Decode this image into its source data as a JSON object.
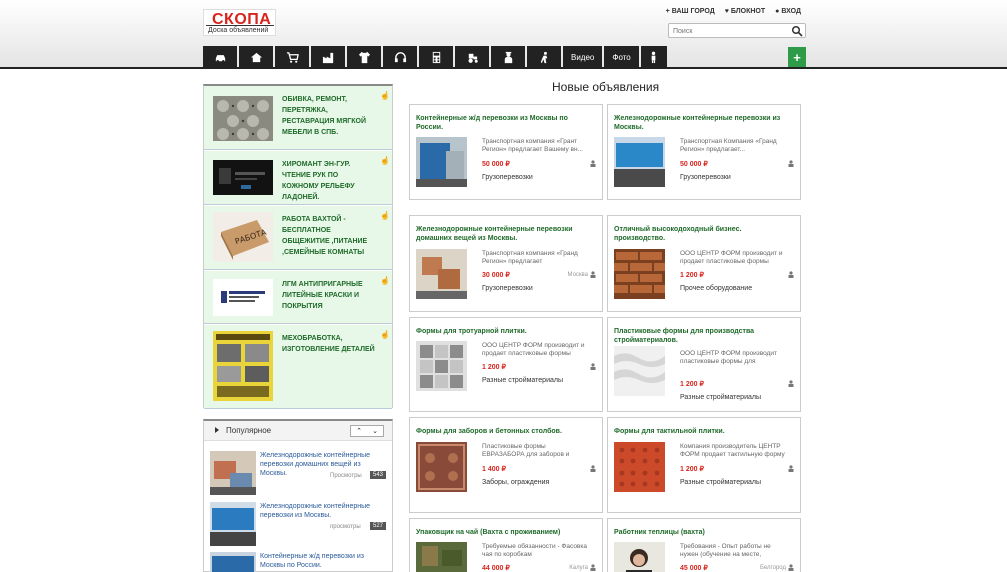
{
  "header": {
    "logo_text": "СКОПА",
    "logo_subtitle": "Доска объявлений",
    "links": [
      {
        "icon": "plus-icon",
        "label": "ВАШ ГОРОД"
      },
      {
        "icon": "heart-icon",
        "label": "БЛОКНОТ"
      },
      {
        "icon": "user-icon",
        "label": "ВХОД"
      }
    ],
    "search_placeholder": "Поиск",
    "add_label": "+"
  },
  "nav": {
    "icons": [
      "car-icon",
      "house-icon",
      "cart-icon",
      "factory-icon",
      "shirt-icon",
      "headphones-icon",
      "calculator-icon",
      "tractor-icon",
      "worker-icon",
      "person-walk-icon"
    ],
    "video_label": "Видео",
    "photo_label": "Фото",
    "last_icon": "person-icon"
  },
  "ads": [
    {
      "title": "ОБИВКА, РЕМОНТ, ПЕРЕТЯЖКА, РЕСТАВРАЦИЯ МЯГКОЙ МЕБЕЛИ В СПБ.",
      "image": "quilted-leather"
    },
    {
      "title": "ХИРОМАНТ ЭН-ГУР. ЧТЕНИЕ РУК ПО КОЖНОМУ РЕЛЬЕФУ ЛАДОНЕЙ.",
      "image": "dark-card"
    },
    {
      "title": "РАБОТА ВАХТОЙ - БЕСПЛАТНОЕ ОБЩЕЖИТИЕ ,ПИТАНИЕ ,СЕМЕЙНЫЕ КОМНАТЫ",
      "image": "work-box"
    },
    {
      "title": "ЛГМ АНТИПРИГАРНЫЕ ЛИТЕЙНЫЕ КРАСКИ И ПОКРЫТИЯ",
      "image": "logo-doc"
    },
    {
      "title": "МЕХОБРАБОТКА, ИЗГОТОВЛЕНИЕ ДЕТАЛЕЙ",
      "image": "yellow-flyer"
    }
  ],
  "popular": {
    "title": "Популярное",
    "items": [
      {
        "text": "Железнодорожные контейнерные перевозки домашних вещей из Москвы.",
        "views_label": "Просмотры",
        "count": "543"
      },
      {
        "text": "Железнодорожные контейнерные перевозки из Москвы.",
        "views_label": "просмотры",
        "count": "527"
      },
      {
        "text": "Контейнерные ж/д перевозки из Москвы по России.",
        "views_label": "",
        "count": ""
      }
    ]
  },
  "main": {
    "title": "Новые объявления",
    "cards": [
      {
        "title": "Контейнерные ж/д перевозки из Москвы по России.",
        "desc": "Транспортная компания «Грант Регион» предлагает Вашему вн...",
        "price": "50 000 ₽",
        "category": "Грузоперевозки",
        "city": "",
        "image": "container-blue"
      },
      {
        "title": "Железнодорожные контейнерные перевозки из Москвы.",
        "desc": "Транспортная Компания «Гранд Регион» предлагает...",
        "price": "50 000 ₽",
        "category": "Грузоперевозки",
        "city": "",
        "image": "train-blue"
      },
      {
        "title": "Железнодорожные контейнерные перевозки домашних вещей из Москвы.",
        "desc": "Транспортная компания «Гранд Регион» предлагает",
        "price": "30 000 ₽",
        "category": "Грузоперевозки",
        "city": "Москва",
        "image": "boxes"
      },
      {
        "title": "Отличный высокодоходный бизнес. производство.",
        "desc": "ООО ЦЕНТР ФОРМ производит и продает пластиковые формы",
        "price": "1 200 ₽",
        "category": "Прочее оборудование",
        "city": "",
        "image": "bricks"
      },
      {
        "title": "Формы для тротуарной плитки.",
        "desc": "ООО ЦЕНТР ФОРМ производит и продает пластиковые формы",
        "price": "1 200 ₽",
        "category": "Разные стройматериалы",
        "city": "",
        "image": "tiles-grey"
      },
      {
        "title": "Пластиковые формы для производства стройматериалов.",
        "desc": "ООО ЦЕНТР ФОРМ производит пластиковые формы для производства",
        "price": "1 200 ₽",
        "category": "Разные стройматериалы",
        "city": "",
        "image": "white-panel"
      },
      {
        "title": "Формы для заборов и бетонных столбов.",
        "desc": "Пластиковые формы ЕВРАЗАБОРА для заборов и столбов. Мы производим",
        "price": "1 400 ₽",
        "category": "Заборы, ограждения",
        "city": "",
        "image": "fence"
      },
      {
        "title": "Формы для тактильной плитки.",
        "desc": "Компания производитель ЦЕНТР ФОРМ продает тактильную форму",
        "price": "1 200 ₽",
        "category": "Разные стройматериалы",
        "city": "",
        "image": "red-tile"
      },
      {
        "title": "Упаковщик на чай (Вахта с проживанием)",
        "desc": "Требуемые обязанности - Фасовка чая по коробкам",
        "price": "44 000 ₽",
        "category": "",
        "city": "Калуга",
        "image": "tea"
      },
      {
        "title": "Работник теплицы (вахта)",
        "desc": "Требования - Опыт работы не нужен (обучение на месте,",
        "price": "45 000 ₽",
        "category": "",
        "city": "Белгород",
        "image": "woman"
      }
    ]
  },
  "colors": {
    "accent_green": "#1f6a2a",
    "price_red": "#d9241c",
    "nav_black": "#222222",
    "ad_bg": "#e8f8e8",
    "add_green": "#2e9b49"
  }
}
